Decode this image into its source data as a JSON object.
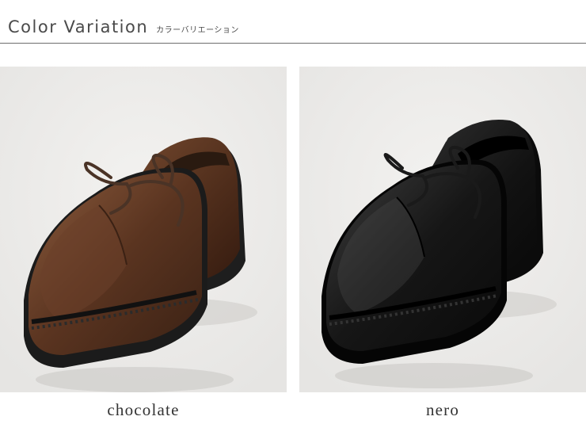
{
  "header": {
    "title": "Color Variation",
    "subtitle": "カラーバリエーション"
  },
  "variants": [
    {
      "label": "chocolate",
      "color": "#5a3420",
      "highlight": "#8a5a3c",
      "lace": "#4a3326"
    },
    {
      "label": "nero",
      "color": "#141414",
      "highlight": "#3a3a3a",
      "lace": "#1a1a1a"
    }
  ]
}
